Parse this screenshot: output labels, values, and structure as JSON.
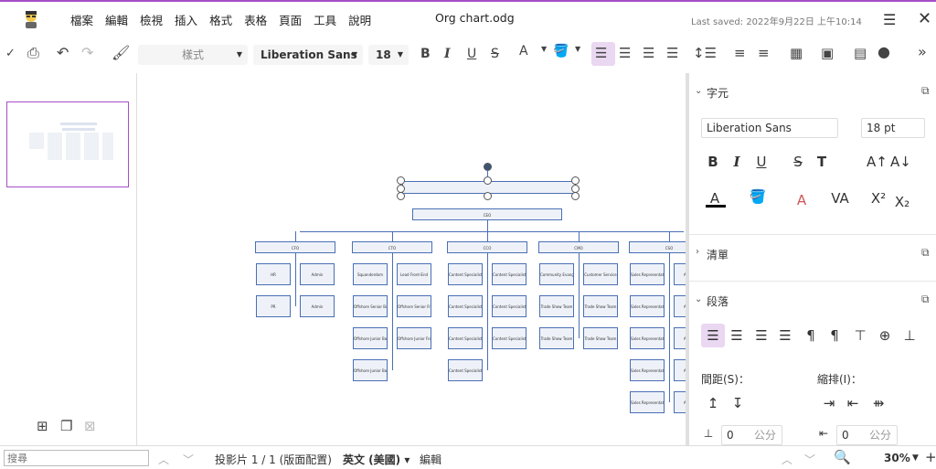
{
  "menu": [
    "檔案",
    "編輯",
    "檢視",
    "插入",
    "格式",
    "表格",
    "頁面",
    "工具",
    "說明"
  ],
  "document": {
    "title": "Org chart.odg",
    "last_saved": "Last saved: 2022年9月22日 上午10:14"
  },
  "toolbar": {
    "style_placeholder": "樣式",
    "font_name": "Liberation Sans",
    "font_size": "18"
  },
  "sidebar": {
    "character": {
      "title": "字元",
      "font_name": "Liberation Sans",
      "font_size": "18 pt"
    },
    "lists": {
      "title": "清單"
    },
    "paragraph": {
      "title": "段落",
      "spacing_label": "間距(S)：",
      "indent_label": "縮排(I)：",
      "spacing_value": "0",
      "indent_value": "0",
      "unit": "公分"
    }
  },
  "status": {
    "search_placeholder": "搜尋",
    "slide_info": "投影片 1 / 1 (版面配置)",
    "language": "英文 (美國)",
    "mode": "編輯",
    "zoom": "30%"
  },
  "org": {
    "top": "CEO",
    "depts": [
      {
        "name": "CFO",
        "children": [
          "HR",
          "Admin",
          "PR",
          "Admin"
        ]
      },
      {
        "name": "CTO",
        "children": [
          "Squanderdom",
          "Lead Front-End",
          "Offshore Senior Back-end",
          "Offshore Senior Front-end",
          "Offshore Junior Back-end",
          "Offshore Junior Front-end",
          "Offshore Junior Back-end"
        ]
      },
      {
        "name": "CCO",
        "children": [
          "Content Specialist",
          "Content Specialist",
          "Content Specialist",
          "Content Specialist",
          "Content Specialist",
          "Content Specialist",
          "Content Specialist"
        ]
      },
      {
        "name": "CMO",
        "children": [
          "Community Evangelist",
          "Customer Service",
          "Trade Show Team",
          "Trade Show Team",
          "Trade Show Team",
          "Trade Show Team"
        ]
      },
      {
        "name": "CSO",
        "children": [
          "Sales Representative",
          "Account",
          "Sales Representative",
          "Account",
          "Sales Representative",
          "Account",
          "Sales Representative",
          "Account",
          "Sales Representative",
          "Account"
        ]
      }
    ]
  }
}
